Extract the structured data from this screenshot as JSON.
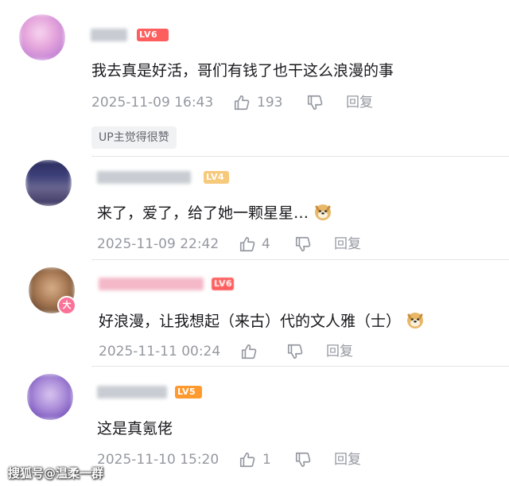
{
  "comments": [
    {
      "level_badge": "LV6",
      "content": "我去真是好活，哥们有钱了也干这么浪漫的事",
      "timestamp": "2025-11-09 16:43",
      "likes": "193",
      "reply_label": "回复",
      "up_tag": "UP主觉得很赞"
    },
    {
      "level_badge": "LV4",
      "content": "来了，爱了，给了她一颗星星…",
      "emoji": "doge-emoji",
      "timestamp": "2025-11-09 22:42",
      "likes": "4",
      "reply_label": "回复"
    },
    {
      "level_badge": "LV6",
      "content": "好浪漫，让我想起（来古）代的文人雅（士）",
      "emoji": "doge-emoji",
      "timestamp": "2025-11-11 00:24",
      "likes": "",
      "reply_label": "回复"
    },
    {
      "level_badge": "LV5",
      "content": "这是真氪佬",
      "timestamp": "2025-11-10 15:20",
      "likes": "1",
      "reply_label": "回复"
    }
  ],
  "watermark": "搜狐号@温柔一群",
  "colors": {
    "lv6": "#ff5e5e",
    "lv5": "#ff9a2e",
    "lv4": "#f7c97b",
    "meta_text": "#9499a0",
    "tag_bg": "#f1f2f3"
  },
  "icons": [
    "like-icon",
    "dislike-icon",
    "doge-emoji"
  ]
}
